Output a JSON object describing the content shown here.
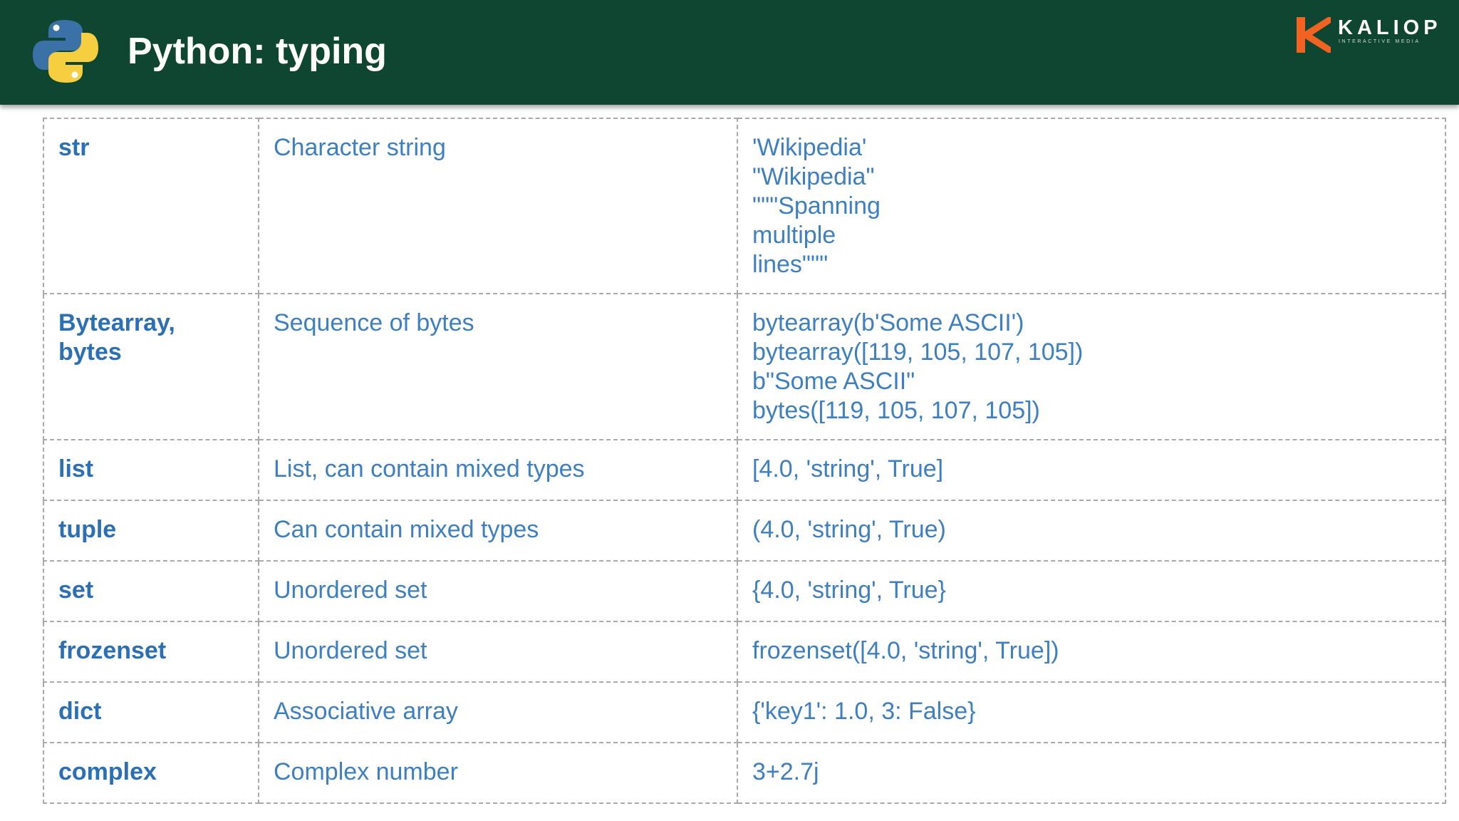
{
  "header": {
    "title": "Python: typing",
    "brand": {
      "name": "KALIOP",
      "tagline": "INTERACTIVE MEDIA"
    }
  },
  "colors": {
    "header_bg": "#0f4632",
    "text_blue": "#3d7fc1",
    "border_grey": "#a9a9a9",
    "python_blue": "#3a72a8",
    "python_yellow": "#f5cf3f",
    "brand_orange": "#f26322"
  },
  "icons": {
    "python_logo": "python-logo-icon",
    "brand_logo": "kaliop-k-icon"
  },
  "table": {
    "rows": [
      {
        "type": "str",
        "description": "Character string",
        "example": "'Wikipedia'\n\"Wikipedia\"\n\"\"\"Spanning\nmultiple\nlines\"\"\""
      },
      {
        "type": "Bytearray, bytes",
        "description": "Sequence of bytes",
        "example": "bytearray(b'Some ASCII')\nbytearray([119, 105, 107, 105])\nb\"Some ASCII\"\nbytes([119, 105, 107, 105])"
      },
      {
        "type": "list",
        "description": "List, can contain mixed types",
        "example": "[4.0, 'string', True]"
      },
      {
        "type": "tuple",
        "description": "Can contain mixed types",
        "example": "(4.0, 'string', True)"
      },
      {
        "type": "set",
        "description": "Unordered set",
        "example": "{4.0, 'string', True}"
      },
      {
        "type": "frozenset",
        "description": "Unordered set",
        "example": "frozenset([4.0, 'string', True])"
      },
      {
        "type": "dict",
        "description": "Associative array",
        "example": "{'key1': 1.0, 3: False}"
      },
      {
        "type": "complex",
        "description": "Complex number",
        "example": "3+2.7j"
      }
    ]
  }
}
